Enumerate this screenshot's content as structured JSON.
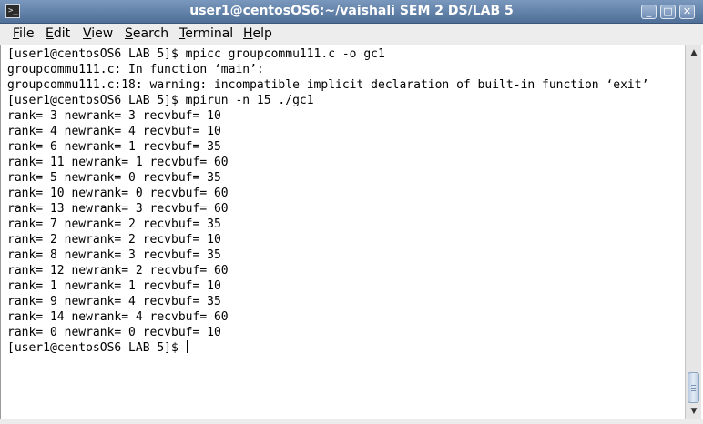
{
  "window": {
    "title": "user1@centosOS6:~/vaishali SEM 2 DS/LAB 5",
    "app_icon": "terminal-icon",
    "controls": {
      "minimize_icon": "_",
      "maximize_icon": "□",
      "close_icon": "✕"
    }
  },
  "menubar": {
    "items": [
      {
        "mnemonic": "F",
        "rest": "ile"
      },
      {
        "mnemonic": "E",
        "rest": "dit"
      },
      {
        "mnemonic": "V",
        "rest": "iew"
      },
      {
        "mnemonic": "S",
        "rest": "earch"
      },
      {
        "mnemonic": "T",
        "rest": "erminal"
      },
      {
        "mnemonic": "H",
        "rest": "elp"
      }
    ]
  },
  "terminal": {
    "lines": [
      "[user1@centosOS6 LAB 5]$ mpicc groupcommu111.c -o gc1",
      "groupcommu111.c: In function ‘main’:",
      "groupcommu111.c:18: warning: incompatible implicit declaration of built-in function ‘exit’",
      "[user1@centosOS6 LAB 5]$ mpirun -n 15 ./gc1",
      "rank= 3 newrank= 3 recvbuf= 10",
      "rank= 4 newrank= 4 recvbuf= 10",
      "rank= 6 newrank= 1 recvbuf= 35",
      "rank= 11 newrank= 1 recvbuf= 60",
      "rank= 5 newrank= 0 recvbuf= 35",
      "rank= 10 newrank= 0 recvbuf= 60",
      "rank= 13 newrank= 3 recvbuf= 60",
      "rank= 7 newrank= 2 recvbuf= 35",
      "rank= 2 newrank= 2 recvbuf= 10",
      "rank= 8 newrank= 3 recvbuf= 35",
      "rank= 12 newrank= 2 recvbuf= 60",
      "rank= 1 newrank= 1 recvbuf= 10",
      "rank= 9 newrank= 4 recvbuf= 35",
      "rank= 14 newrank= 4 recvbuf= 60",
      "rank= 0 newrank= 0 recvbuf= 10"
    ],
    "prompt": "[user1@centosOS6 LAB 5]$ "
  },
  "scrollbar": {
    "up_icon": "▲",
    "down_icon": "▼"
  }
}
